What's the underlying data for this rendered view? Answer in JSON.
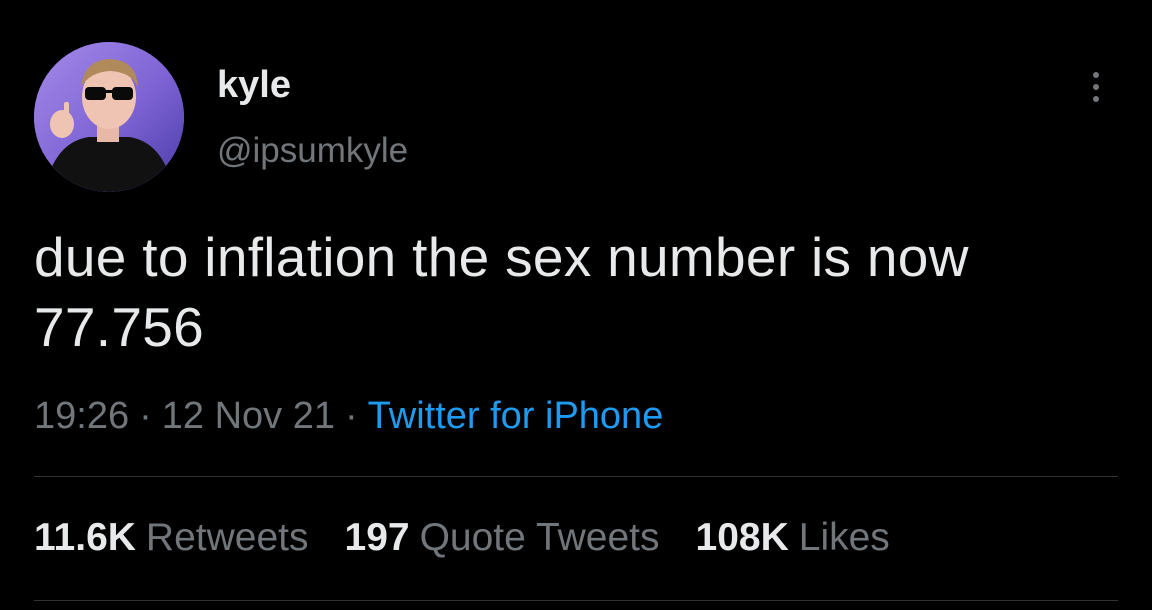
{
  "tweet": {
    "author": {
      "display_name": "kyle",
      "handle": "@ipsumkyle"
    },
    "text_line1": "due to inflation the sex number is now",
    "text_line2": "77.756",
    "time": "19:26",
    "date": "12 Nov 21",
    "separator": "·",
    "source": "Twitter for iPhone",
    "stats": {
      "retweets_count": "11.6K",
      "retweets_label": "Retweets",
      "quotes_count": "197",
      "quotes_label": "Quote Tweets",
      "likes_count": "108K",
      "likes_label": "Likes"
    }
  },
  "icons": {
    "more": "more-vertical-icon"
  },
  "colors": {
    "background": "#000000",
    "primary_text": "#e7e9ea",
    "secondary_text": "#71767b",
    "link": "#1d9bf0",
    "divider": "#2f3336"
  }
}
